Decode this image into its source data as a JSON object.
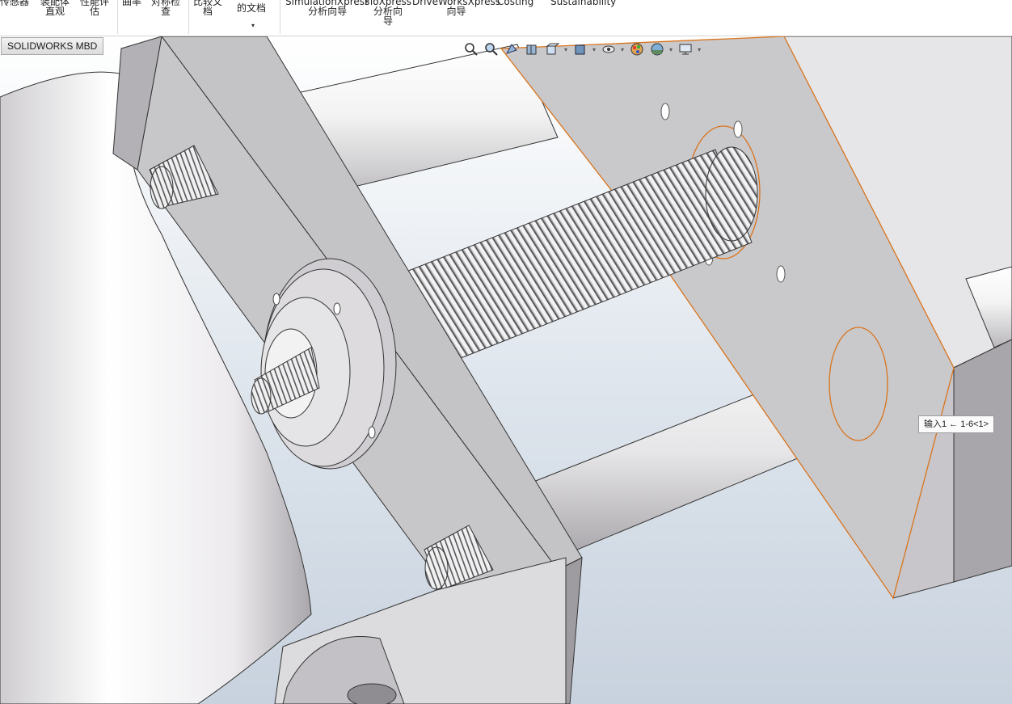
{
  "ribbon": {
    "buttons": [
      {
        "line1": "传感器",
        "line2": ""
      },
      {
        "line1": "装配体",
        "line2": "直观"
      },
      {
        "line1": "性能评",
        "line2": "估"
      },
      {
        "line1": "曲率",
        "line2": ""
      },
      {
        "line1": "对称检",
        "line2": "查"
      },
      {
        "line1": "比较文",
        "line2": "档"
      },
      {
        "line1": "的文档",
        "line2": ""
      },
      {
        "line1": "SimulationXpress",
        "line2": "分析向导",
        "line3": ""
      },
      {
        "line1": "FloXpress",
        "line2": "分析向",
        "line3": "导"
      },
      {
        "line1": "DriveWorksXpress",
        "line2": "向导",
        "line3": ""
      },
      {
        "line1": "Costing",
        "line2": "",
        "line3": ""
      },
      {
        "line1": "Sustainability",
        "line2": "",
        "line3": ""
      }
    ]
  },
  "tabs": {
    "active_label": "SOLIDWORKS MBD"
  },
  "hud": {
    "icons": [
      "zoom-to-fit-icon",
      "zoom-to-area-icon",
      "previous-view-icon",
      "section-view-icon",
      "view-orientation-icon",
      "display-style-icon",
      "hide-show-items-icon",
      "edit-appearance-icon",
      "apply-scene-icon",
      "view-settings-icon"
    ]
  },
  "tooltip": {
    "text": "输入1 ← 1-6<1>"
  },
  "colors": {
    "accent": "#d9741c",
    "background_top": "#ffffff",
    "background_bottom": "#c5d0dd"
  }
}
